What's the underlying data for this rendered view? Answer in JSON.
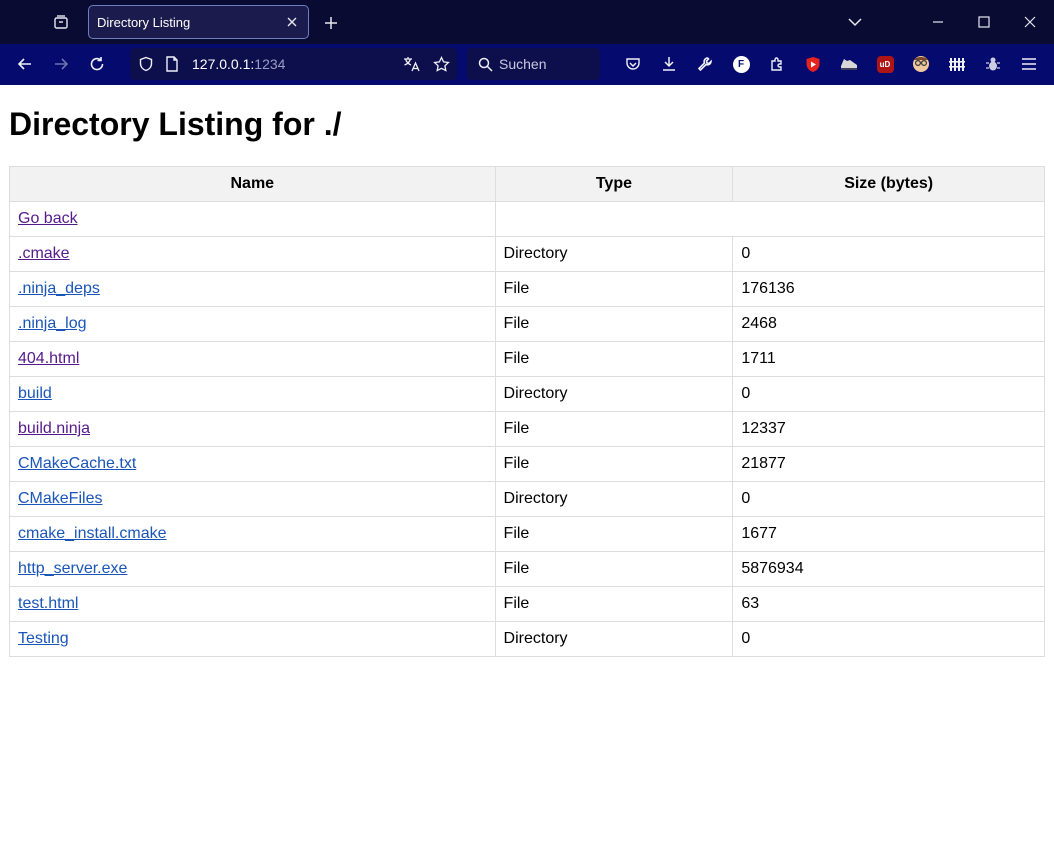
{
  "browser": {
    "tab_title": "Directory Listing",
    "url_host": "127.0.0.1:",
    "url_port": "1234",
    "search_placeholder": "Suchen",
    "ext_f_label": "F",
    "ext_ublock_label": "uD"
  },
  "page": {
    "heading": "Directory Listing for ./",
    "columns": [
      "Name",
      "Type",
      "Size (bytes)"
    ],
    "go_back": "Go back",
    "rows": [
      {
        "name": ".cmake",
        "type": "Directory",
        "size": "0"
      },
      {
        "name": ".ninja_deps",
        "type": "File",
        "size": "176136"
      },
      {
        "name": ".ninja_log",
        "type": "File",
        "size": "2468"
      },
      {
        "name": "404.html",
        "type": "File",
        "size": "1711"
      },
      {
        "name": "build",
        "type": "Directory",
        "size": "0"
      },
      {
        "name": "build.ninja",
        "type": "File",
        "size": "12337"
      },
      {
        "name": "CMakeCache.txt",
        "type": "File",
        "size": "21877"
      },
      {
        "name": "CMakeFiles",
        "type": "Directory",
        "size": "0"
      },
      {
        "name": "cmake_install.cmake",
        "type": "File",
        "size": "1677"
      },
      {
        "name": "http_server.exe",
        "type": "File",
        "size": "5876934"
      },
      {
        "name": "test.html",
        "type": "File",
        "size": "63"
      },
      {
        "name": "Testing",
        "type": "Directory",
        "size": "0"
      }
    ]
  },
  "colors": {
    "titlebar_bg": "#0a0b33",
    "navbar_bg": "#040a6e",
    "link": "#1a55b8",
    "link_visited": "#551a8b"
  }
}
